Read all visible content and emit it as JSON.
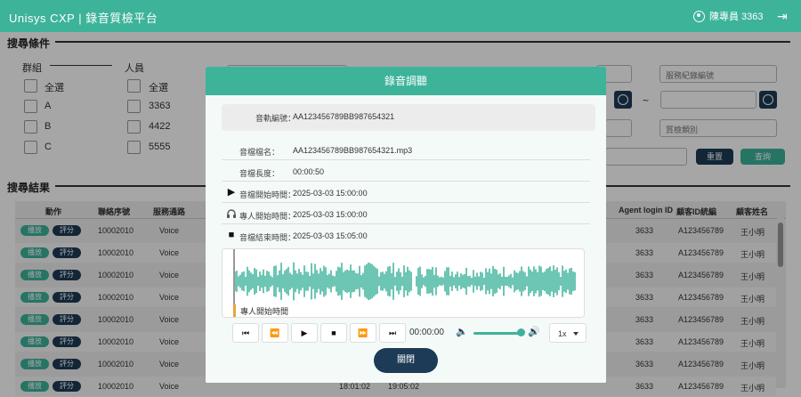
{
  "header": {
    "title": "Unisys  CXP  |  錄音質檢平台",
    "user": "陳專員 3363"
  },
  "search": {
    "title": "搜尋條件",
    "group_label": "群組",
    "person_label": "人員",
    "groups": [
      "全選",
      "A",
      "B",
      "C"
    ],
    "persons": [
      "全選",
      "3363",
      "4422",
      "5555"
    ],
    "record_placeholder": "服務紀錄編號",
    "tilde": "~",
    "category_placeholder": "質檢類別",
    "reset_label": "重置",
    "search_label": "查詢"
  },
  "results": {
    "title": "搜尋結果",
    "columns": [
      "動作",
      "聯絡序號",
      "服務通路",
      "Agent login ID",
      "顧客ID統編",
      "顧客姓名"
    ],
    "play_label": "播放",
    "score_label": "評分",
    "rows": [
      {
        "id": "10002010",
        "channel": "Voice",
        "agent": "3633",
        "customer_id": "A123456789",
        "name": "王小明"
      },
      {
        "id": "10002010",
        "channel": "Voice",
        "agent": "3633",
        "customer_id": "A123456789",
        "name": "王小明"
      },
      {
        "id": "10002010",
        "channel": "Voice",
        "agent": "3633",
        "customer_id": "A123456789",
        "name": "王小明"
      },
      {
        "id": "10002010",
        "channel": "Voice",
        "agent": "3633",
        "customer_id": "A123456789",
        "name": "王小明"
      },
      {
        "id": "10002010",
        "channel": "Voice",
        "agent": "3633",
        "customer_id": "A123456789",
        "name": "王小明"
      },
      {
        "id": "10002010",
        "channel": "Voice",
        "agent": "3633",
        "customer_id": "A123456789",
        "name": "王小明"
      },
      {
        "id": "10002010",
        "channel": "Voice",
        "agent": "3633",
        "customer_id": "A123456789",
        "name": "王小明"
      },
      {
        "id": "10002010",
        "channel": "Voice",
        "agent": "3633",
        "customer_id": "A123456789",
        "name": "王小明"
      }
    ],
    "bottom_times": [
      "18:01:02",
      "19:05:02"
    ]
  },
  "modal": {
    "title": "錄音調聽",
    "track_label": "音軌編號：",
    "track_value": "AA123456789BB987654321",
    "filename_label": "音檔檔名：",
    "filename_value": "AA123456789BB987654321.mp3",
    "length_label": "音檔長度：",
    "length_value": "00:00:50",
    "start_label": "音檔開始時間：",
    "start_value": "2025-03-03 15:00:00",
    "agent_start_label": "專人開始時間：",
    "agent_start_value": "2025-03-03 15:00:00",
    "end_label": "音檔結束時間：",
    "end_value": "2025-03-03 15:05:00",
    "marker_label": "專人開始時間",
    "time_display": "00:00:00",
    "speed": "1x",
    "volume": 0.95,
    "close_label": "關閉",
    "controls": [
      "⏮",
      "⏪",
      "▶",
      "■",
      "⏩",
      "⏭"
    ],
    "colors": {
      "accent": "#3db39a",
      "dark": "#1d3b57",
      "marker": "#e8a33d"
    }
  }
}
